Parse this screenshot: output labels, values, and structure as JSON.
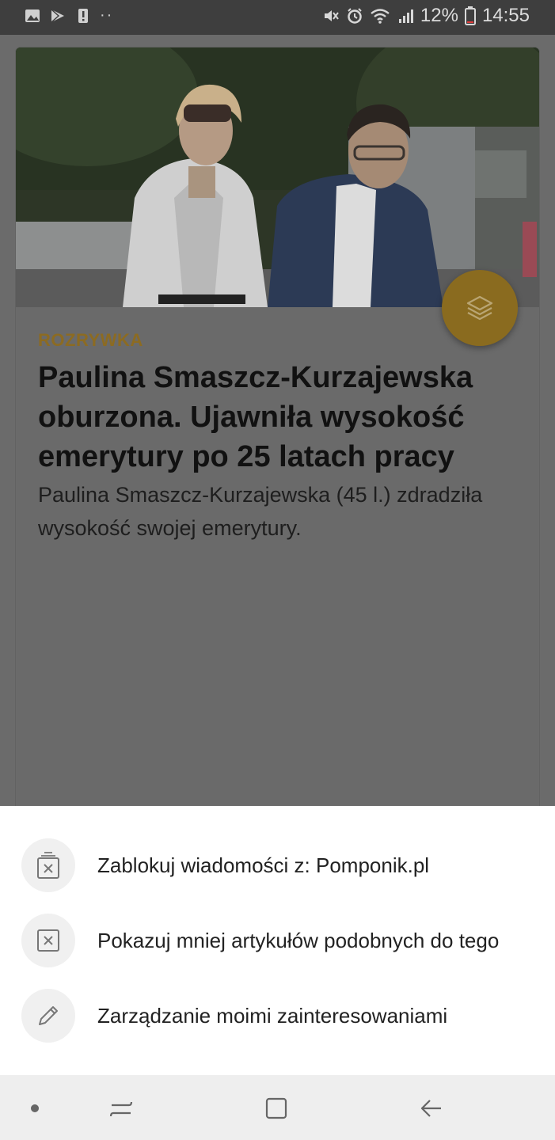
{
  "status_bar": {
    "battery_percent": "12%",
    "time": "14:55",
    "left_icons": [
      "image-icon",
      "play-store-icon",
      "alert-icon",
      "more-dots-icon"
    ],
    "right_icons": [
      "mute-icon",
      "alarm-icon",
      "wifi-icon",
      "signal-icon",
      "battery-icon"
    ]
  },
  "article": {
    "category": "ROZRYWKA",
    "title": "Paulina Smaszcz-Kurzajewska oburzona. Ujawniła wysokość emerytury po 25 latach pracy",
    "lead": "Paulina Smaszcz-Kurzajewska (45 l.) zdradziła wysokość swojej emerytury.",
    "fab_icon": "layers-icon",
    "colors": {
      "category": "#8c6b22",
      "fab": "#8a6b1f"
    }
  },
  "sheet": {
    "items": [
      {
        "label": "Zablokuj wiadomości z: Pomponik.pl",
        "icon": "block-source-icon"
      },
      {
        "label": "Pokazuj mniej artykułów podobnych do tego",
        "icon": "show-less-icon"
      },
      {
        "label": "Zarządzanie moimi zainteresowaniami",
        "icon": "pencil-icon"
      }
    ]
  },
  "navbar": {
    "buttons": [
      "dot-icon",
      "recents-icon",
      "home-icon",
      "back-icon"
    ]
  }
}
